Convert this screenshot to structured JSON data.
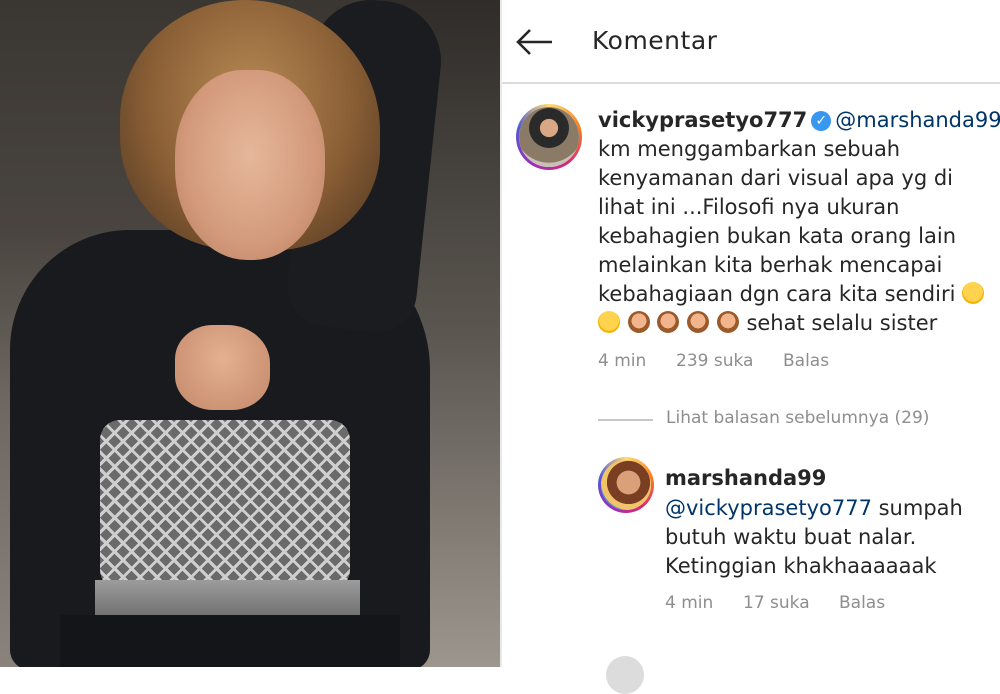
{
  "header": {
    "title": "Komentar"
  },
  "comment1": {
    "username": "vickyprasetyo777",
    "mention": "@marshanda99",
    "lines": [
      "km menggambarkan sebuah",
      "kenyamanan dari visual apa yg di",
      "lihat ini ...Filosofi nya ukuran",
      "kebahagien bukan kata orang lain",
      "melainkan kita berhak mencapai",
      "kebahagiaan dgn cara kita sendiri"
    ],
    "last_line_text": "sehat selalu sister",
    "time": "4 min",
    "likes": "239 suka",
    "reply": "Balas"
  },
  "view_replies": "Lihat balasan sebelumnya (29)",
  "comment2": {
    "username": "marshanda99",
    "mention": "@vickyprasetyo777",
    "line1_rest": " sumpah",
    "line2": "butuh waktu buat nalar.",
    "line3": "Ketinggian khakhaaaaaak",
    "time": "4 min",
    "likes": "17 suka",
    "reply": "Balas"
  },
  "icons": {
    "back": "arrow-left-icon",
    "verified": "verified-badge-icon",
    "emoji_smile": "smiling-face-emoji",
    "emoji_monkey": "see-no-evil-monkey-emoji"
  },
  "colors": {
    "text": "#262626",
    "meta": "#8e8e8e",
    "verified": "#3897f0",
    "mention": "#003569"
  }
}
